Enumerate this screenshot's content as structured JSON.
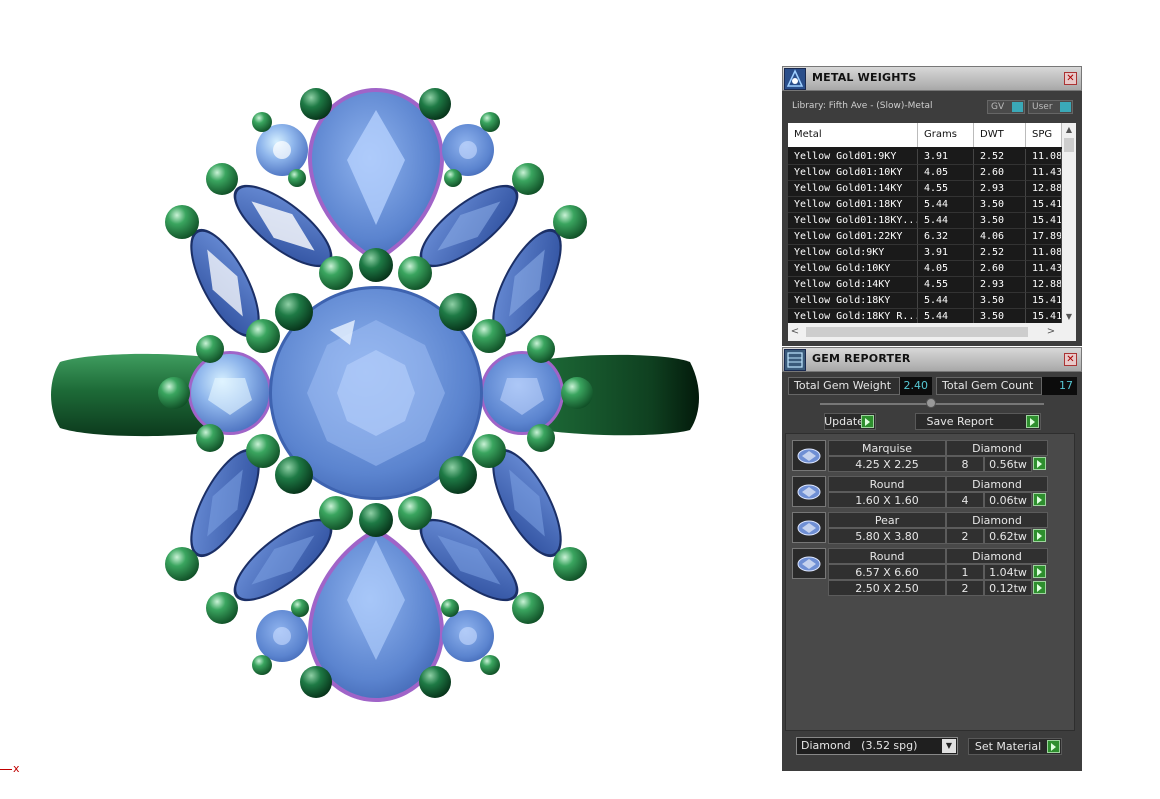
{
  "viewport": {
    "axis_label": "x"
  },
  "metal_panel": {
    "title": "METAL WEIGHTS",
    "library": "Library: Fifth Ave - (Slow)-Metal",
    "toggle_gv": "GV",
    "toggle_user": "User",
    "columns": [
      "Metal",
      "Grams",
      "DWT",
      "SPG"
    ],
    "rows": [
      [
        "Yellow Gold01:9KY",
        "3.91",
        "2.52",
        "11.08"
      ],
      [
        "Yellow Gold01:10KY",
        "4.05",
        "2.60",
        "11.43"
      ],
      [
        "Yellow Gold01:14KY",
        "4.55",
        "2.93",
        "12.88"
      ],
      [
        "Yellow Gold01:18KY",
        "5.44",
        "3.50",
        "15.41"
      ],
      [
        "Yellow Gold01:18KY...",
        "5.44",
        "3.50",
        "15.41"
      ],
      [
        "Yellow Gold01:22KY",
        "6.32",
        "4.06",
        "17.89"
      ],
      [
        "Yellow Gold:9KY",
        "3.91",
        "2.52",
        "11.08"
      ],
      [
        "Yellow Gold:10KY",
        "4.05",
        "2.60",
        "11.43"
      ],
      [
        "Yellow Gold:14KY",
        "4.55",
        "2.93",
        "12.88"
      ],
      [
        "Yellow Gold:18KY",
        "5.44",
        "3.50",
        "15.41"
      ],
      [
        "Yellow Gold:18KY R...",
        "5.44",
        "3.50",
        "15.41"
      ]
    ]
  },
  "gem_panel": {
    "title": "GEM REPORTER",
    "total_weight_label": "Total Gem Weight",
    "total_weight": "2.40",
    "total_count_label": "Total Gem Count",
    "total_count": "17",
    "update_label": "Update",
    "save_report_label": "Save Report",
    "groups": [
      {
        "shape": "Marquise",
        "material": "Diamond",
        "rows": [
          {
            "size": "4.25 X 2.25",
            "count": "8",
            "weight": "0.56tw"
          }
        ]
      },
      {
        "shape": "Round",
        "material": "Diamond",
        "rows": [
          {
            "size": "1.60 X 1.60",
            "count": "4",
            "weight": "0.06tw"
          }
        ]
      },
      {
        "shape": "Pear",
        "material": "Diamond",
        "rows": [
          {
            "size": "5.80 X 3.80",
            "count": "2",
            "weight": "0.62tw"
          }
        ]
      },
      {
        "shape": "Round",
        "material": "Diamond",
        "rows": [
          {
            "size": "6.57 X 6.60",
            "count": "1",
            "weight": "1.04tw"
          },
          {
            "size": "2.50 X 2.50",
            "count": "2",
            "weight": "0.12tw"
          }
        ]
      }
    ],
    "material_select": "Diamond   (3.52 spg)",
    "set_material_label": "Set Material"
  },
  "colors": {
    "band": "#1f6b3a",
    "gem_blue": "#4f77c4",
    "prong_green": "#2a8a4c",
    "accent_cyan": "#56c7d3",
    "go_green": "#2e8f2e"
  }
}
